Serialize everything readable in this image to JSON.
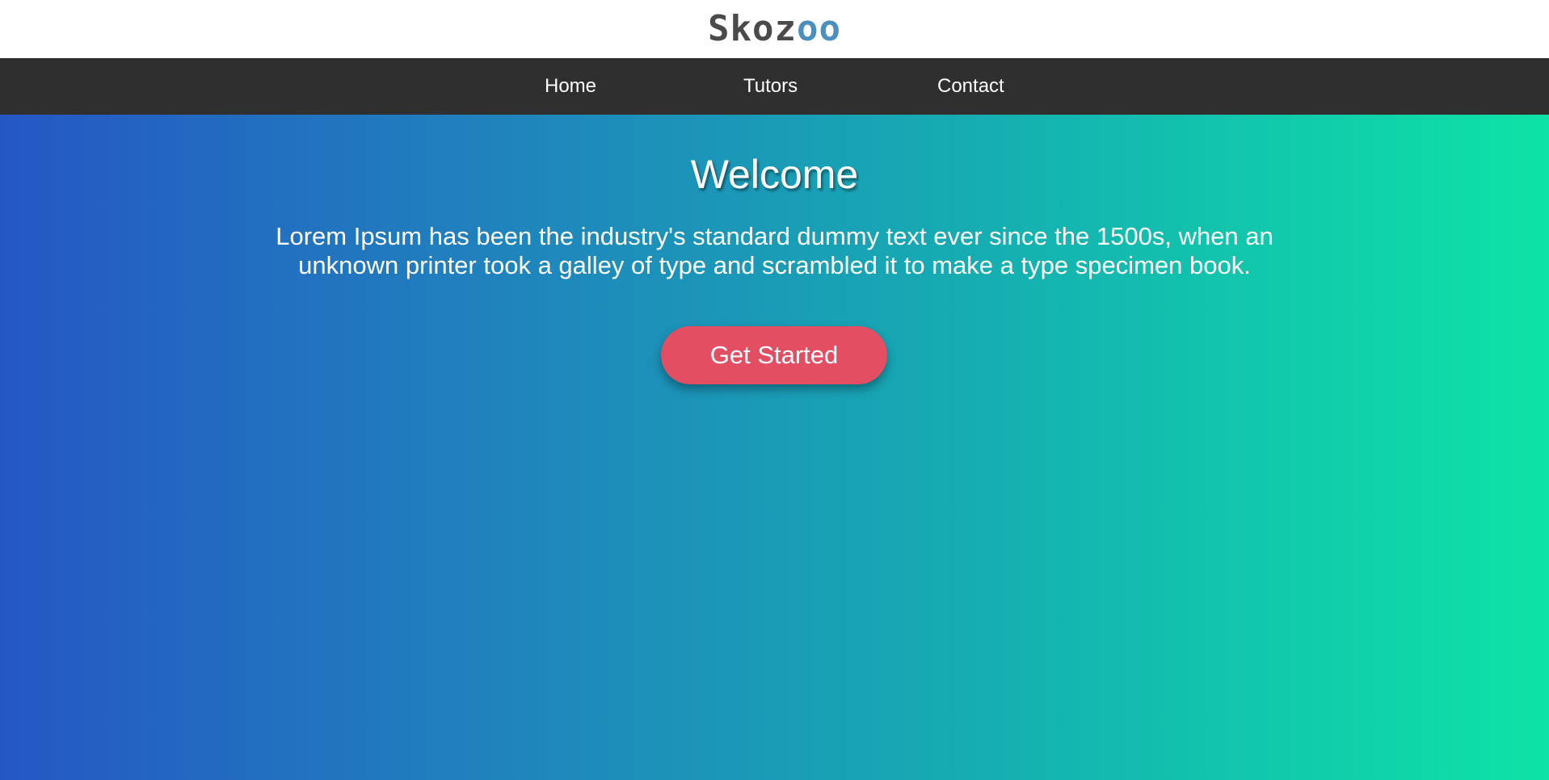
{
  "brand": {
    "logo_part1": "Skoz",
    "logo_part2": "oo",
    "logo_colors": {
      "dark": "#4a4a4a",
      "accent": "#4a8fbe"
    }
  },
  "nav": {
    "background": "#2f2f2f",
    "items": [
      {
        "label": "Home"
      },
      {
        "label": "Tutors"
      },
      {
        "label": "Contact"
      }
    ]
  },
  "hero": {
    "gradient": [
      "#2557c4",
      "#1f87bc",
      "#15b0b1",
      "#0de3a6"
    ],
    "title": "Welcome",
    "text": "Lorem Ipsum has been the industry's standard dummy text ever since the 1500s, when an unknown printer took a galley of type and scrambled it to make a type specimen book.",
    "cta_label": "Get Started",
    "cta_color": "#e34e63"
  }
}
